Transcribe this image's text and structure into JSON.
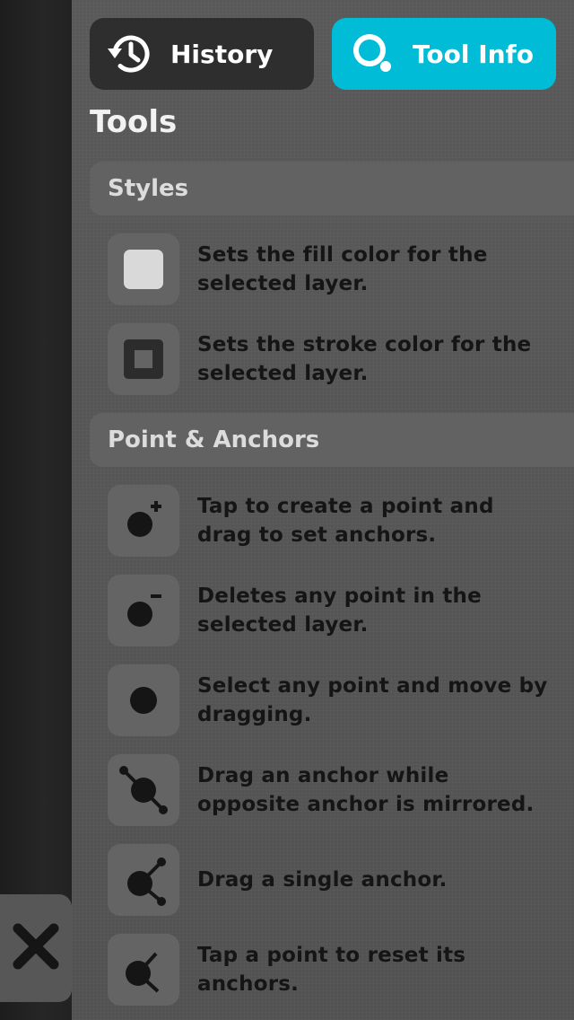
{
  "tabs": {
    "history_label": "History",
    "tool_info_label": "Tool Info"
  },
  "title": "Tools",
  "sections": [
    {
      "header": "Styles",
      "items": [
        {
          "icon": "fill-color-icon",
          "text": "Sets the fill color for the\nselected layer."
        },
        {
          "icon": "stroke-color-icon",
          "text": "Sets the stroke color for the\nselected layer."
        }
      ]
    },
    {
      "header": "Point & Anchors",
      "items": [
        {
          "icon": "add-point-icon",
          "text": "Tap to create a point and\ndrag to set anchors."
        },
        {
          "icon": "delete-point-icon",
          "text": "Deletes any point in the\nselected layer."
        },
        {
          "icon": "select-point-icon",
          "text": "Select any point and move by\ndragging."
        },
        {
          "icon": "mirrored-anchor-icon",
          "text": "Drag an anchor while\nopposite anchor is mirrored."
        },
        {
          "icon": "single-anchor-icon",
          "text": "Drag a single anchor."
        },
        {
          "icon": "reset-anchor-icon",
          "text": "Tap a point to reset its\nanchors."
        }
      ]
    }
  ],
  "colors": {
    "accent": "#00bcd6",
    "panel_bg": "#555555",
    "dark_tab": "#2e2e2e"
  },
  "close_icon": "close-icon"
}
